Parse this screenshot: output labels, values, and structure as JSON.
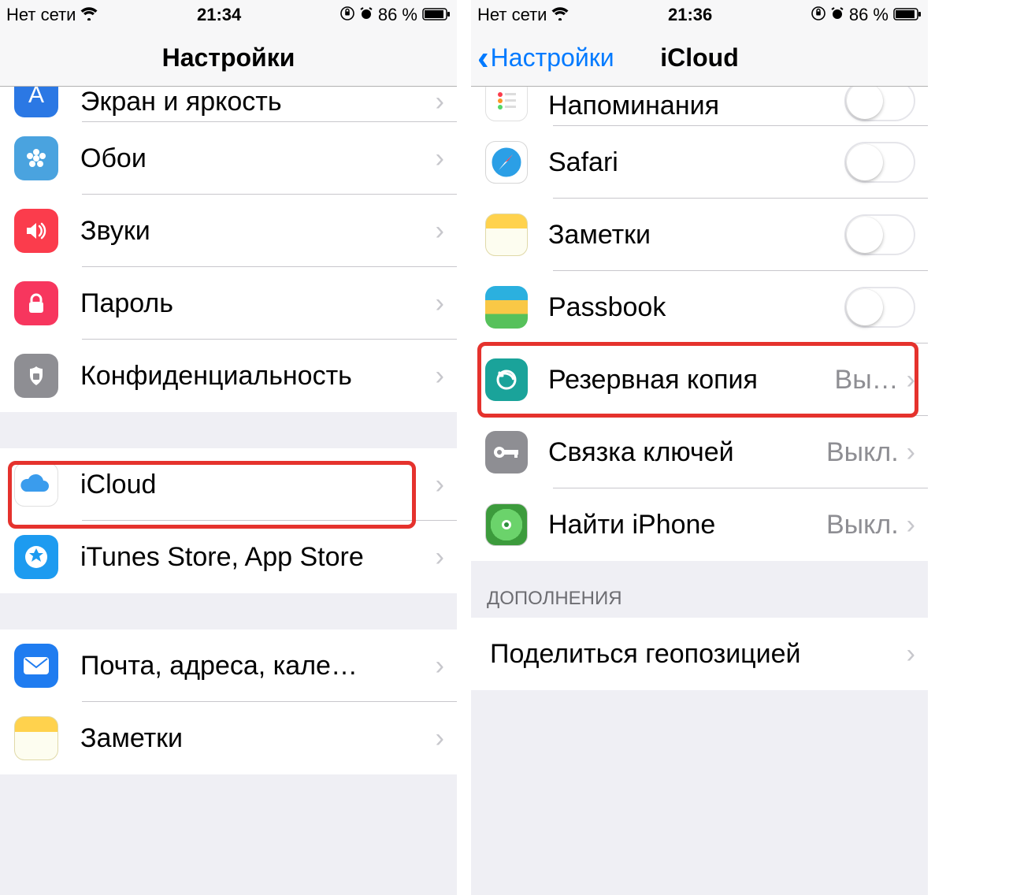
{
  "left": {
    "status": {
      "carrier": "Нет сети",
      "time": "21:34",
      "battery": "86 %"
    },
    "title": "Настройки",
    "partial_top_label": "Экран и яркость",
    "rows": [
      {
        "key": "wallpaper",
        "label": "Обои"
      },
      {
        "key": "sounds",
        "label": "Звуки"
      },
      {
        "key": "passcode",
        "label": "Пароль"
      },
      {
        "key": "privacy",
        "label": "Конфиденциальность"
      }
    ],
    "group2": [
      {
        "key": "icloud",
        "label": "iCloud"
      },
      {
        "key": "itunes",
        "label": "iTunes Store, App Store"
      }
    ],
    "group3": [
      {
        "key": "mail",
        "label": "Почта, адреса, кале…"
      },
      {
        "key": "notes",
        "label": "Заметки"
      }
    ]
  },
  "right": {
    "status": {
      "carrier": "Нет сети",
      "time": "21:36",
      "battery": "86 %"
    },
    "back_label": "Настройки",
    "title": "iCloud",
    "partial_top_label": "Напоминания",
    "toggles": [
      {
        "key": "safari",
        "label": "Safari"
      },
      {
        "key": "notes",
        "label": "Заметки"
      },
      {
        "key": "passbook",
        "label": "Passbook"
      }
    ],
    "links": [
      {
        "key": "backup",
        "label": "Резервная копия",
        "value": "Вы…"
      },
      {
        "key": "keychain",
        "label": "Связка ключей",
        "value": "Выкл."
      },
      {
        "key": "findmy",
        "label": "Найти iPhone",
        "value": "Выкл."
      }
    ],
    "section_header": "ДОПОЛНЕНИЯ",
    "share_row": {
      "label": "Поделиться геопозицией"
    }
  }
}
